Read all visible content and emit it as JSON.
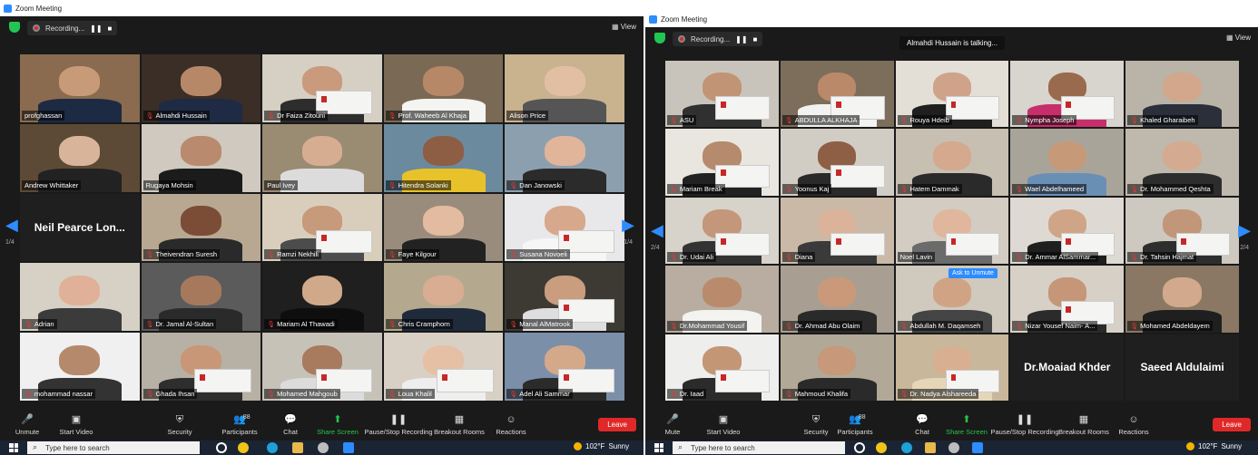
{
  "left": {
    "window_title": "Zoom Meeting",
    "recording_label": "Recording...",
    "pause_symbol": "❚❚",
    "stop_symbol": "■",
    "view_label": "View",
    "page_indicator": "1/4",
    "tiles": [
      {
        "name": "profghassan",
        "muted": false,
        "bg": "#8a6b4f",
        "skin": "#c79a78",
        "shirt": "#1d2a44",
        "cert": false
      },
      {
        "name": "Almahdi Hussain",
        "muted": true,
        "bg": "#3a2e26",
        "skin": "#b78868",
        "shirt": "#1f2b44",
        "cert": false
      },
      {
        "name": "Dr Faiza Zitouni",
        "muted": true,
        "bg": "#d6cfc4",
        "skin": "#c99a7c",
        "shirt": "#2d2d2d",
        "cert": true
      },
      {
        "name": "Prof. Waheeb Al Khaja",
        "muted": true,
        "bg": "#7a6a55",
        "skin": "#b78867",
        "shirt": "#f4f4f0",
        "cert": false
      },
      {
        "name": "Alison Price",
        "muted": false,
        "bg": "#c9b28e",
        "skin": "#e2bfa3",
        "shirt": "#555555",
        "cert": false
      },
      {
        "name": "Andrew Whittaker",
        "muted": false,
        "bg": "#5c4a36",
        "skin": "#d8b49b",
        "shirt": "#222222",
        "cert": false
      },
      {
        "name": "Rugaya Mohsin",
        "muted": false,
        "bg": "#cfc9bf",
        "skin": "#b98a6e",
        "shirt": "#1b1b1b",
        "cert": false,
        "active": true
      },
      {
        "name": "Paul Ivey",
        "muted": false,
        "bg": "#9a8b73",
        "skin": "#d7ad92",
        "shirt": "#dcdcdc",
        "cert": false
      },
      {
        "name": "Hitendra Solanki",
        "muted": true,
        "bg": "#6c8a9e",
        "skin": "#8d5e44",
        "shirt": "#e8c22a",
        "cert": false
      },
      {
        "name": "Dan Janowski",
        "muted": true,
        "bg": "#8c9fae",
        "skin": "#e0b59a",
        "shirt": "#2b2b2b",
        "cert": false
      },
      {
        "name": "Neil Pearce Lon...",
        "text_only": true
      },
      {
        "name": "Theivendran Suresh",
        "muted": true,
        "bg": "#b8a892",
        "skin": "#7b4d36",
        "shirt": "#2a2a2a",
        "cert": false
      },
      {
        "name": "Ramzi Nekhili",
        "muted": true,
        "bg": "#d9cebc",
        "skin": "#c69a7a",
        "shirt": "#4c4c4c",
        "cert": true
      },
      {
        "name": "Faye Kilgour",
        "muted": true,
        "bg": "#9a8c7c",
        "skin": "#e3bba0",
        "shirt": "#222222",
        "cert": false
      },
      {
        "name": "Susana Novoeli",
        "muted": true,
        "bg": "#e8e8ea",
        "skin": "#d7a88b",
        "shirt": "#f6f6f6",
        "cert": true
      },
      {
        "name": "Adrian",
        "muted": true,
        "bg": "#d7d0c4",
        "skin": "#e0b198",
        "shirt": "#3b3b3b",
        "cert": false
      },
      {
        "name": "Dr. Jamal Al-Sultan",
        "muted": true,
        "bg": "#5b5b5b",
        "skin": "#a6795c",
        "shirt": "#2a2a2a",
        "cert": false
      },
      {
        "name": "Mariam Al Thawadi",
        "muted": true,
        "bg": "#1f1f1f",
        "skin": "#d0a98a",
        "shirt": "#0e0e0e",
        "cert": false
      },
      {
        "name": "Chris Cramphorn",
        "muted": true,
        "bg": "#b4a98f",
        "skin": "#d9ad91",
        "shirt": "#1f2a3a",
        "cert": false
      },
      {
        "name": "Manal AlMatrook",
        "muted": true,
        "bg": "#3d3a34",
        "skin": "#c99d7e",
        "shirt": "#dedede",
        "cert": true
      },
      {
        "name": "mohammad nassar",
        "muted": true,
        "bg": "#f0f0f0",
        "skin": "#b58a6c",
        "shirt": "#333333",
        "cert": false
      },
      {
        "name": "Ghada Ihsan",
        "muted": true,
        "bg": "#b7b0a5",
        "skin": "#c89777",
        "shirt": "#2e2e2e",
        "cert": true
      },
      {
        "name": "Mohamed Mahgoub",
        "muted": true,
        "bg": "#c7c2b8",
        "skin": "#a87b5e",
        "shirt": "#dcdcdc",
        "cert": true
      },
      {
        "name": "Loua Khalil",
        "muted": true,
        "bg": "#d8d0c4",
        "skin": "#e6c0a5",
        "shirt": "#eeeeee",
        "cert": true
      },
      {
        "name": "Adel Ali Sammar",
        "muted": true,
        "bg": "#7b8fa8",
        "skin": "#d3a98a",
        "shirt": "#2b2b2b",
        "cert": true
      }
    ],
    "toolbar": [
      {
        "label": "Unmute",
        "icon": "🎤"
      },
      {
        "label": "Start Video",
        "icon": "▣"
      },
      {
        "label": "Security",
        "icon": "⛨"
      },
      {
        "label": "Participants",
        "icon": "👥",
        "count": "88"
      },
      {
        "label": "Chat",
        "icon": "💬"
      },
      {
        "label": "Share Screen",
        "icon": "⬆"
      },
      {
        "label": "Pause/Stop Recording",
        "icon": "❚❚"
      },
      {
        "label": "Breakout Rooms",
        "icon": "▦"
      },
      {
        "label": "Reactions",
        "icon": "☺"
      }
    ],
    "leave_label": "Leave",
    "search_placeholder": "Type here to search",
    "weather_temp": "102°F",
    "weather_cond": "Sunny"
  },
  "right": {
    "window_title": "Zoom Meeting",
    "recording_label": "Recording...",
    "pause_symbol": "❚❚",
    "stop_symbol": "■",
    "talking_banner": "Almahdi Hussain is talking...",
    "view_label": "View",
    "page_indicator": "2/4",
    "ask_unmute": "Ask to Unmute",
    "tiles": [
      {
        "name": "ASU",
        "muted": true,
        "bg": "#c9c4bb",
        "skin": "#c19476",
        "shirt": "#303030",
        "cert": true
      },
      {
        "name": "ABDULLA ALKHAJA",
        "muted": true,
        "bg": "#7d6d5b",
        "skin": "#b9896a",
        "shirt": "#f2f2f0",
        "cert": true
      },
      {
        "name": "Rouya Hdeib",
        "muted": true,
        "bg": "#e3ded6",
        "skin": "#cfa28a",
        "shirt": "#1f1f1f",
        "cert": true
      },
      {
        "name": "Nympha Joseph",
        "muted": true,
        "bg": "#d8d4ce",
        "skin": "#9a6a4e",
        "shirt": "#c62f6b",
        "cert": true
      },
      {
        "name": "Khaled Gharaibeh",
        "muted": true,
        "bg": "#b9b3a8",
        "skin": "#d3a78c",
        "shirt": "#2b2f3a",
        "cert": false
      },
      {
        "name": "Mariam Break",
        "muted": true,
        "bg": "#e9e6e0",
        "skin": "#b68a6d",
        "shirt": "#222222",
        "cert": true
      },
      {
        "name": "Yoonus Kaj",
        "muted": true,
        "bg": "#d2cdc4",
        "skin": "#8e5f45",
        "shirt": "#2a2a2a",
        "cert": true
      },
      {
        "name": "Hatem Dammak",
        "muted": true,
        "bg": "#c7bfb1",
        "skin": "#d4a98e",
        "shirt": "#2a2a2a",
        "cert": false
      },
      {
        "name": "Wael Abdelhameed",
        "muted": true,
        "bg": "#a9a49a",
        "skin": "#c69979",
        "shirt": "#6a8fb5",
        "cert": false
      },
      {
        "name": "Dr. Mohammed Qeshta",
        "muted": true,
        "bg": "#bfb8ad",
        "skin": "#d4ab90",
        "shirt": "#2d2d2d",
        "cert": false
      },
      {
        "name": "Dr. Udai Ali",
        "muted": true,
        "bg": "#d7d2ca",
        "skin": "#c4967a",
        "shirt": "#333333",
        "cert": true
      },
      {
        "name": "Diana",
        "muted": true,
        "bg": "#c9b9a6",
        "skin": "#dab39a",
        "shirt": "#3a3a3a",
        "cert": true
      },
      {
        "name": "Noel Lavin",
        "muted": false,
        "bg": "#d2ccc2",
        "skin": "#e0b69d",
        "shirt": "#6b6b6b",
        "cert": true
      },
      {
        "name": "Dr. Ammar AlSammar...",
        "muted": true,
        "bg": "#dedad3",
        "skin": "#d0a587",
        "shirt": "#1f1f1f",
        "cert": true
      },
      {
        "name": "Dr. Tahsin Hajmat",
        "muted": true,
        "bg": "#cdc8c0",
        "skin": "#c29678",
        "shirt": "#2e2e2e",
        "cert": true
      },
      {
        "name": "Dr.Mohammad Yousif",
        "muted": true,
        "bg": "#b8ada0",
        "skin": "#b98b6c",
        "shirt": "#f3f3f0",
        "cert": false
      },
      {
        "name": "Dr. Ahmad Abu Olaim",
        "muted": true,
        "bg": "#a89f92",
        "skin": "#c9997a",
        "shirt": "#2a2a2a",
        "cert": false
      },
      {
        "name": "Abdullah M. Daqamseh",
        "muted": true,
        "bg": "#cfc9be",
        "skin": "#d1a385",
        "shirt": "#444444",
        "cert": false
      },
      {
        "name": "Nizar Yousef Naim- A...",
        "muted": true,
        "bg": "#d6d0c6",
        "skin": "#c59778",
        "shirt": "#2b2b2b",
        "cert": true
      },
      {
        "name": "Mohamed Abdeldayem",
        "muted": true,
        "bg": "#8a7864",
        "skin": "#d2a98c",
        "shirt": "#1f1f1f",
        "cert": false
      },
      {
        "name": "Dr. Iaad",
        "muted": true,
        "bg": "#eeeeec",
        "skin": "#c39676",
        "shirt": "#2b2b2b",
        "cert": true
      },
      {
        "name": "Mahmoud Khalifa",
        "muted": true,
        "bg": "#b1a897",
        "skin": "#c7987a",
        "shirt": "#2a2a2a",
        "cert": false
      },
      {
        "name": "Dr. Nadya Alshareeda",
        "muted": true,
        "bg": "#c8b79a",
        "skin": "#d8b091",
        "shirt": "#e5d6b8",
        "cert": true
      },
      {
        "name": "Dr.Moaiad Khder",
        "text_only": true
      },
      {
        "name": "Saeed Aldulaimi",
        "text_only": true
      }
    ],
    "toolbar": [
      {
        "label": "Mute",
        "icon": "🎤"
      },
      {
        "label": "Start Video",
        "icon": "▣"
      },
      {
        "label": "Security",
        "icon": "⛨"
      },
      {
        "label": "Participants",
        "icon": "👥",
        "count": "88"
      },
      {
        "label": "Chat",
        "icon": "💬"
      },
      {
        "label": "Share Screen",
        "icon": "⬆"
      },
      {
        "label": "Pause/Stop Recording",
        "icon": "❚❚"
      },
      {
        "label": "Breakout Rooms",
        "icon": "▦"
      },
      {
        "label": "Reactions",
        "icon": "☺"
      }
    ],
    "leave_label": "Leave",
    "search_placeholder": "Type here to search",
    "weather_temp": "102°F",
    "weather_cond": "Sunny"
  }
}
